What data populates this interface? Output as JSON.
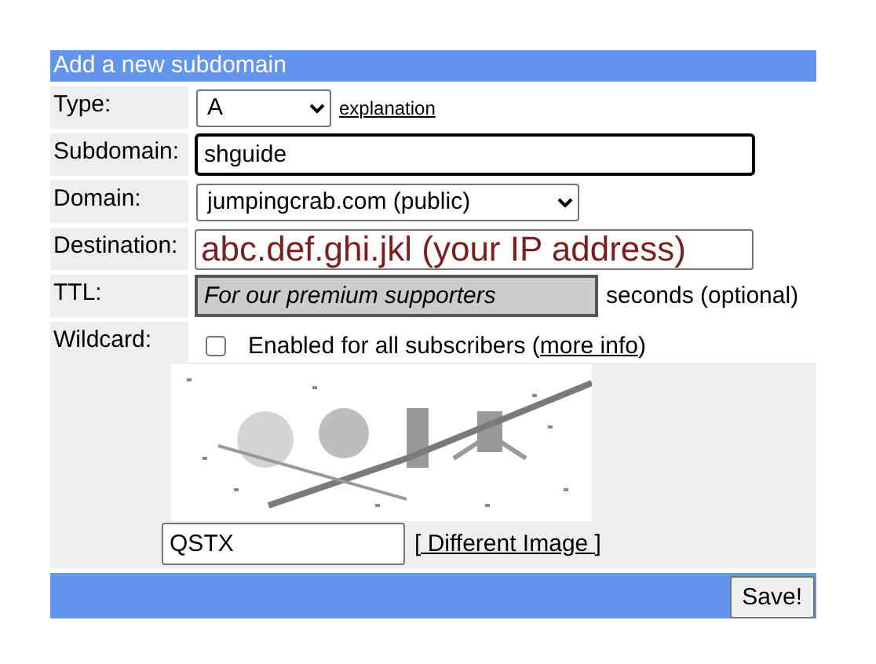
{
  "header": {
    "title": "Add a new subdomain"
  },
  "fields": [
    {
      "kind": "select",
      "label": "Type:",
      "value": "A",
      "link": "explanation"
    },
    {
      "kind": "text",
      "label": "Subdomain:",
      "value": "shguide",
      "focused": true
    },
    {
      "kind": "select",
      "label": "Domain:",
      "value": "jumpingcrab.com (public)"
    },
    {
      "kind": "address",
      "label": "Destination:",
      "value": "abc.def.ghi.jkl (your IP address)"
    },
    {
      "kind": "text",
      "label": "TTL:",
      "value": "For our premium supporters",
      "disabled": true,
      "suffix": "seconds (optional)"
    },
    {
      "kind": "checkbox",
      "label": "Wildcard:",
      "checked": false,
      "text": "Enabled for all subscribers (",
      "link": "more info",
      "text_after": ")"
    }
  ],
  "captcha": {
    "answer": "QSTX",
    "link": "[ Different Image ]"
  },
  "footer": {
    "button": "Save!"
  }
}
